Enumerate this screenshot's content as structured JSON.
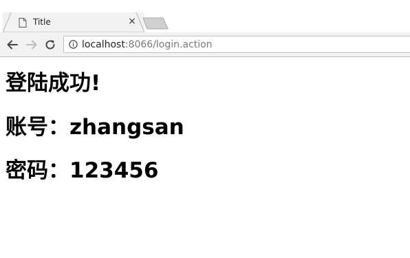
{
  "tab": {
    "title": "Title",
    "close_glyph": "×",
    "icon": "file-icon"
  },
  "toolbar": {
    "back_icon": "back-arrow-icon",
    "forward_icon": "forward-arrow-icon",
    "reload_icon": "reload-icon"
  },
  "address": {
    "icon": "info-icon",
    "host": "localhost",
    "rest": ":8066/login.action"
  },
  "content": {
    "heading": "登陆成功!",
    "account": "账号：zhangsan",
    "password": "密码：123456"
  }
}
